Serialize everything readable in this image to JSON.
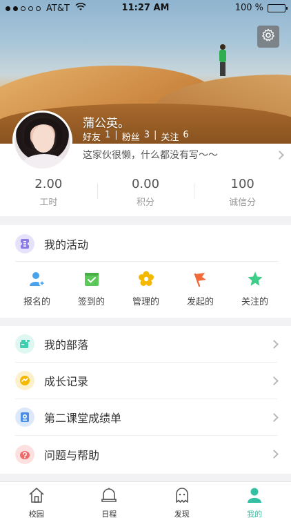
{
  "status_bar": {
    "carrier": "AT&T",
    "time": "11:27 AM",
    "battery": "100 %"
  },
  "profile": {
    "name": "蒲公英。",
    "friends_label": "好友",
    "friends": "1",
    "fans_label": "粉丝",
    "fans": "3",
    "following_label": "关注",
    "following": "6",
    "separator": "|",
    "bio": "这家伙很懒，什么都没有写～～"
  },
  "stats": [
    {
      "value": "2.00",
      "label": "工时"
    },
    {
      "value": "0.00",
      "label": "积分"
    },
    {
      "value": "100",
      "label": "诚信分"
    }
  ],
  "activity": {
    "title": "我的活动",
    "items": [
      {
        "label": "报名的",
        "icon": "person-add-icon",
        "color": "#4aa3ea"
      },
      {
        "label": "签到的",
        "icon": "calendar-check-icon",
        "color": "#5cc85a"
      },
      {
        "label": "管理的",
        "icon": "gear-flower-icon",
        "color": "#f5b800"
      },
      {
        "label": "发起的",
        "icon": "flag-icon",
        "color": "#f06a3a"
      },
      {
        "label": "关注的",
        "icon": "star-icon",
        "color": "#3fce8a"
      }
    ]
  },
  "menu": [
    {
      "label": "我的部落",
      "icon": "tribe-icon",
      "color": "#3ecfb0",
      "bg": "#dff7f1"
    },
    {
      "label": "成长记录",
      "icon": "growth-icon",
      "color": "#f5b800",
      "bg": "#fdf1cc"
    },
    {
      "label": "第二课堂成绩单",
      "icon": "transcript-icon",
      "color": "#4a8ee8",
      "bg": "#dde9fb"
    },
    {
      "label": "问题与帮助",
      "icon": "help-icon",
      "color": "#f06a6a",
      "bg": "#fde0e0"
    }
  ],
  "tabs": [
    {
      "label": "校园",
      "icon": "home-icon"
    },
    {
      "label": "日程",
      "icon": "bell-icon"
    },
    {
      "label": "发现",
      "icon": "ghost-icon"
    },
    {
      "label": "我的",
      "icon": "user-icon",
      "active": true
    }
  ]
}
